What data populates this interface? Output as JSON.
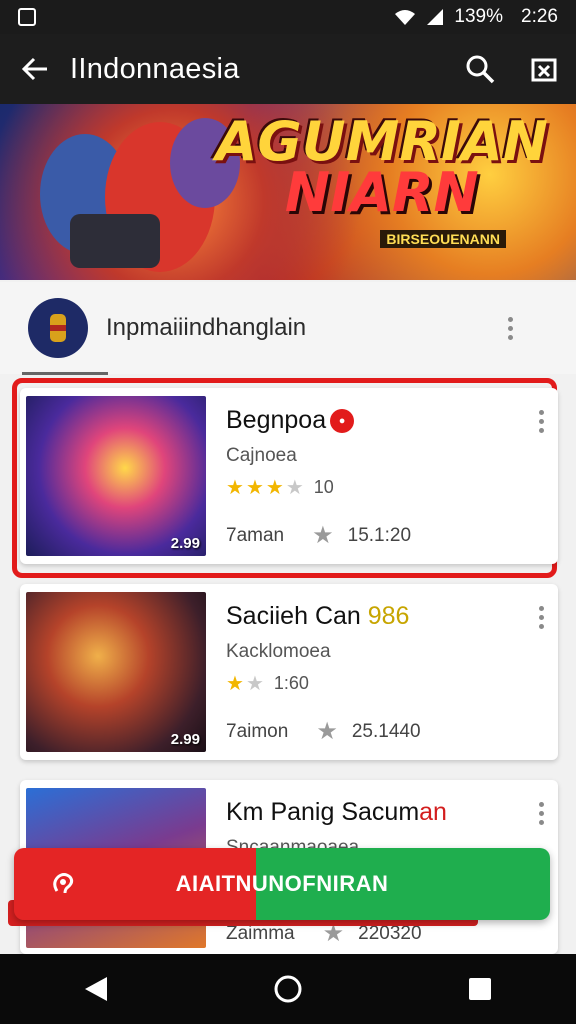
{
  "status_bar": {
    "battery": "139%",
    "time": "2:26"
  },
  "app_bar": {
    "title": "IIndonnaesia"
  },
  "banner": {
    "title_line1": "AGUMRIAN",
    "title_line2": "NIARN",
    "subtitle": "BIRSEOUENANN"
  },
  "section": {
    "title": "Inpmaiiindhanglain"
  },
  "cards": [
    {
      "title": "Begnpoa",
      "subtitle": "Cajnoea",
      "stars": 3,
      "rating": "10",
      "footer_label": "7aman",
      "footer_value": "15.1:20",
      "thumb_badge": "2.99"
    },
    {
      "title": "Saciieh Can ",
      "title_extra": "986",
      "subtitle": "Kacklomoea",
      "stars": 1,
      "rating": "1:60",
      "footer_label": "7aimon",
      "footer_value": "25.1440",
      "thumb_badge": "2.99"
    },
    {
      "title": "Km Panig Sacum",
      "title_extra": "an",
      "subtitle": "Sncaanmaoaea",
      "footer_label": "Zaimma",
      "footer_value": "220320"
    }
  ],
  "action": {
    "label": "AIAITNUNOFNIRAN"
  },
  "colors": {
    "accent_red": "#e21b1b",
    "accent_green": "#1fae4e",
    "app_bar": "#1d1d1d"
  },
  "icons": [
    "back-arrow-icon",
    "search-icon",
    "share-icon",
    "more-vert-icon",
    "star-icon",
    "nav-back-icon",
    "nav-home-icon",
    "nav-recents-icon"
  ]
}
